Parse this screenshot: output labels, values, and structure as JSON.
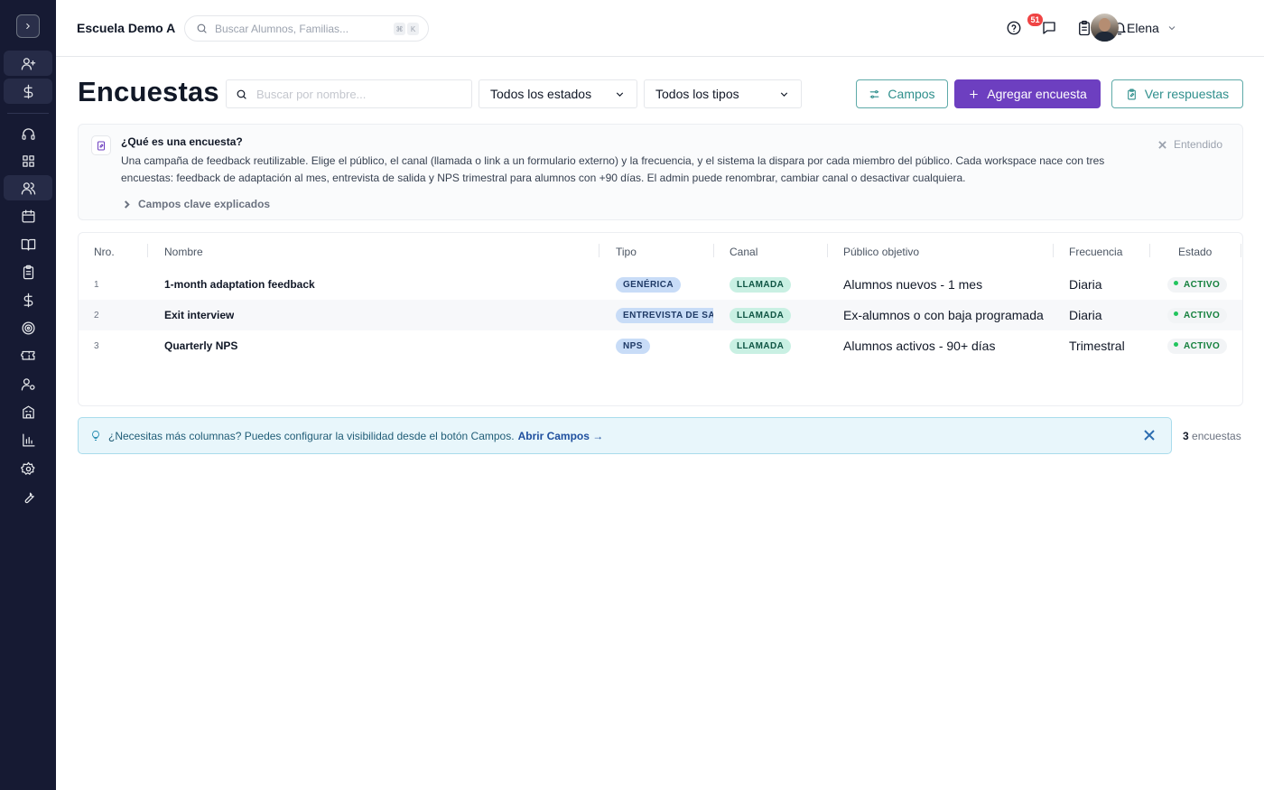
{
  "topbar": {
    "school_name": "Escuela Demo A",
    "search_placeholder": "Buscar Alumnos, Familias...",
    "kbd_cmd": "⌘",
    "kbd_key": "K",
    "notification_count": "51",
    "user_name": "Elena"
  },
  "page": {
    "title": "Encuestas",
    "search_placeholder": "Buscar por nombre...",
    "status_filter": "Todos los estados",
    "type_filter": "Todos los tipos",
    "btn_campos": "Campos",
    "btn_add": "Agregar encuesta",
    "btn_responses": "Ver respuestas"
  },
  "info": {
    "title": "¿Qué es una encuesta?",
    "body": "Una campaña de feedback reutilizable. Elige el público, el canal (llamada o link a un formulario externo) y la frecuencia, y el sistema la dispara por cada miembro del público. Cada workspace nace con tres encuestas: feedback de adaptación al mes, entrevista de salida y NPS trimestral para alumnos con +90 días. El admin puede renombrar, cambiar canal o desactivar cualquiera.",
    "dismiss": "Entendido",
    "toggle": "Campos clave explicados"
  },
  "table": {
    "headers": {
      "nro": "Nro.",
      "nombre": "Nombre",
      "tipo": "Tipo",
      "canal": "Canal",
      "publico": "Público objetivo",
      "frecuencia": "Frecuencia",
      "estado": "Estado"
    },
    "rows": [
      {
        "nro": "1",
        "nombre": "1-month adaptation feedback",
        "tipo": "GENÉRICA",
        "canal": "LLAMADA",
        "publico": "Alumnos nuevos - 1 mes",
        "frecuencia": "Diaria",
        "estado": "ACTIVO"
      },
      {
        "nro": "2",
        "nombre": "Exit interview",
        "tipo": "ENTREVISTA DE SA",
        "canal": "LLAMADA",
        "publico": "Ex-alumnos o con baja programada",
        "frecuencia": "Diaria",
        "estado": "ACTIVO"
      },
      {
        "nro": "3",
        "nombre": "Quarterly NPS",
        "tipo": "NPS",
        "canal": "LLAMADA",
        "publico": "Alumnos activos - 90+ días",
        "frecuencia": "Trimestral",
        "estado": "ACTIVO"
      }
    ]
  },
  "tip": {
    "text": "¿Necesitas más columnas? Puedes configurar la visibilidad desde el botón Campos.",
    "link": "Abrir Campos →"
  },
  "footer": {
    "count": "3",
    "count_label": "encuestas"
  },
  "colors": {
    "sidebar_bg": "#161a33",
    "primary": "#6d3fc0",
    "accent_teal": "#2f8f8c",
    "badge_red": "#ef4444"
  },
  "sidebar": {
    "icons": [
      "chevron-right-icon",
      "user-plus-icon",
      "dollar-icon",
      "headset-icon",
      "grid-icon",
      "users-icon",
      "calendar-icon",
      "book-icon",
      "clipboard-icon",
      "dollar-icon",
      "target-icon",
      "ticket-icon",
      "user-gear-icon",
      "building-icon",
      "bar-chart-icon",
      "settings-icon",
      "wrench-icon"
    ]
  }
}
